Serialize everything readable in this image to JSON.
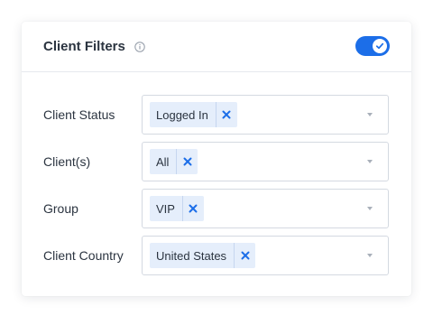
{
  "header": {
    "title": "Client Filters",
    "toggle_enabled": true
  },
  "colors": {
    "accent": "#1c6ee8",
    "chip_bg": "#e5eefb",
    "text": "#2b3440"
  },
  "filters": [
    {
      "label": "Client Status",
      "value": "Logged In"
    },
    {
      "label": "Client(s)",
      "value": "All"
    },
    {
      "label": "Group",
      "value": "VIP"
    },
    {
      "label": "Client Country",
      "value": "United States"
    }
  ],
  "icons": {
    "info": "info-icon",
    "remove": "close-icon",
    "caret": "chevron-down-icon",
    "toggle_check": "check-icon"
  }
}
